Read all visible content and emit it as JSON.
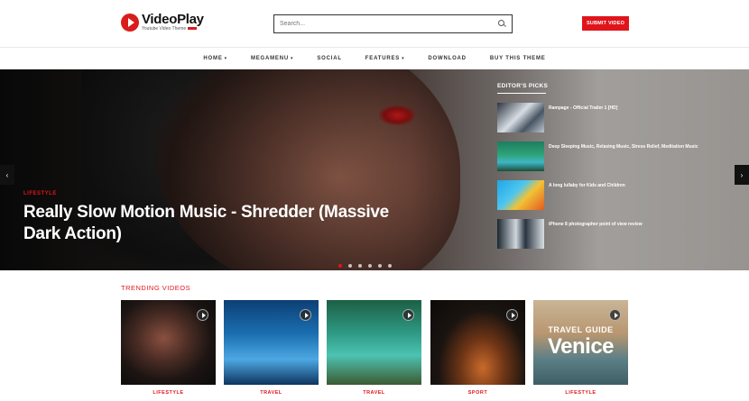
{
  "brand": {
    "name": "VideoPlay",
    "tagline": "Youtube Video Theme",
    "accent": "#e0151c"
  },
  "search": {
    "placeholder": "Search..."
  },
  "header": {
    "submit_label": "SUBMIT VIDEO"
  },
  "nav": {
    "items": [
      {
        "label": "HOME",
        "dropdown": true
      },
      {
        "label": "MEGAMENU",
        "dropdown": true
      },
      {
        "label": "SOCIAL",
        "dropdown": false
      },
      {
        "label": "FEATURES",
        "dropdown": true
      },
      {
        "label": "DOWNLOAD",
        "dropdown": false
      },
      {
        "label": "BUY THIS THEME",
        "dropdown": false
      }
    ],
    "caret": "▾"
  },
  "hero": {
    "category": "LIFESTYLE",
    "title": "Really Slow Motion Music - Shredder (Massive Dark Action)",
    "prev": "‹",
    "next": "›",
    "slide_count": 6,
    "active_slide": 1
  },
  "editors_picks": {
    "title": "EDITOR'S PICKS",
    "items": [
      {
        "title": "Rampage - Official Trailer 1 [HD]"
      },
      {
        "title": "Deep Sleeping Music, Relaxing Music, Stress Relief, Meditation Music"
      },
      {
        "title": "A long lullaby for Kids and Children"
      },
      {
        "title": "iPhone 8 photographer point of view review"
      }
    ]
  },
  "trending": {
    "title": "TRENDING VIDEOS",
    "items": [
      {
        "category": "LIFESTYLE"
      },
      {
        "category": "TRAVEL"
      },
      {
        "category": "TRAVEL"
      },
      {
        "category": "SPORT"
      },
      {
        "category": "LIFESTYLE",
        "overlay_sub": "TRAVEL GUIDE",
        "overlay_main": "Venice"
      }
    ]
  }
}
